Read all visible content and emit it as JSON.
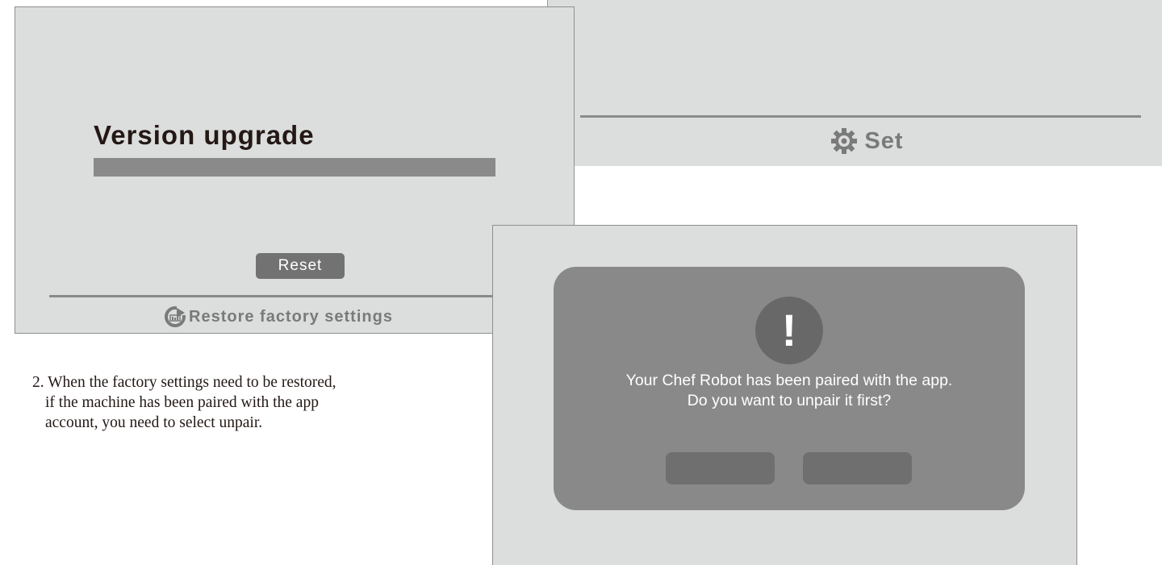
{
  "set_screen": {
    "footer_label": "Set",
    "footer_icon": "gear-icon"
  },
  "restore_screen": {
    "title": "Version upgrade",
    "reset_label": "Reset",
    "footer_label": "Restore factory settings",
    "footer_icon": "restore-icon"
  },
  "instruction": {
    "line1": "2. When the factory settings need to be restored,",
    "line2": "if the machine has been paired with the app",
    "line3": "account, you need to select unpair."
  },
  "dialog": {
    "icon": "alert-icon",
    "icon_glyph": "!",
    "message_line1": "Your Chef Robot has been paired with the app.",
    "message_line2": "Do you want to unpair it first?"
  },
  "colors": {
    "screen_bg": "#dcdddd",
    "dialog_bg": "#898989",
    "button_bg": "#6f6f6f",
    "divider": "#8a8a8a",
    "title_text": "#231815"
  }
}
